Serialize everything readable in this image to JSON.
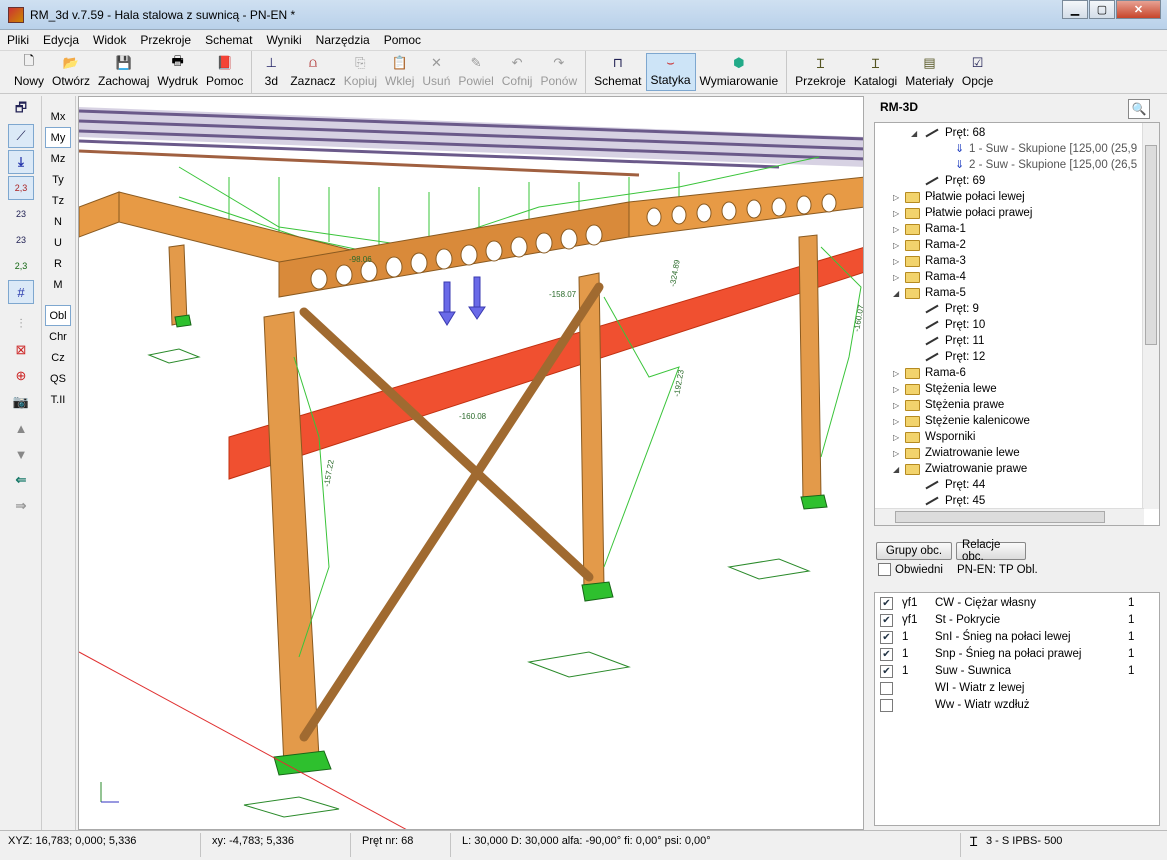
{
  "window": {
    "title": "RM_3d v.7.59 - Hala stalowa z suwnicą - PN-EN *"
  },
  "menu": [
    "Pliki",
    "Edycja",
    "Widok",
    "Przekroje",
    "Schemat",
    "Wyniki",
    "Narzędzia",
    "Pomoc"
  ],
  "toolbar": {
    "file": [
      {
        "label": "Nowy"
      },
      {
        "label": "Otwórz"
      },
      {
        "label": "Zachowaj"
      },
      {
        "label": "Wydruk"
      },
      {
        "label": "Pomoc"
      }
    ],
    "edit": [
      {
        "label": "3d"
      },
      {
        "label": "Zaznacz"
      },
      {
        "label": "Kopiuj"
      },
      {
        "label": "Wklej"
      },
      {
        "label": "Usuń"
      },
      {
        "label": "Powiel"
      },
      {
        "label": "Cofnij"
      },
      {
        "label": "Ponów"
      }
    ],
    "mode": [
      {
        "label": "Schemat"
      },
      {
        "label": "Statyka"
      },
      {
        "label": "Wymiarowanie"
      }
    ],
    "data": [
      {
        "label": "Przekroje"
      },
      {
        "label": "Katalogi"
      },
      {
        "label": "Materiały"
      },
      {
        "label": "Opcje"
      }
    ]
  },
  "result_tabs": [
    "Mx",
    "My",
    "Mz",
    "Ty",
    "Tz",
    "N",
    "U",
    "R",
    "M"
  ],
  "result_tabs2": [
    "Obl",
    "Chr",
    "Cz",
    "QS",
    "T.II"
  ],
  "left_tools_labels": [
    "2,3",
    "23",
    "23",
    "2,3"
  ],
  "viewport": {
    "diagram_labels": [
      "-324.89",
      "-192.23",
      "-157.22",
      "-98.06",
      "-160.08",
      "-158.07",
      "-160.07"
    ]
  },
  "tree": {
    "title": "RM-3D",
    "rows": [
      {
        "type": "member",
        "label": "Pręt: 68",
        "indent": 48,
        "exp": "◢"
      },
      {
        "type": "load",
        "label": "1 - Suw - Skupione [125,00 (25,9",
        "indent": 80
      },
      {
        "type": "load",
        "label": "2 - Suw - Skupione [125,00 (26,5",
        "indent": 80
      },
      {
        "type": "member",
        "label": "Pręt: 69",
        "indent": 48
      },
      {
        "type": "folder",
        "label": "Płatwie połaci lewej",
        "indent": 30,
        "exp": "▷"
      },
      {
        "type": "folder",
        "label": "Płatwie połaci prawej",
        "indent": 30,
        "exp": "▷"
      },
      {
        "type": "folder",
        "label": "Rama-1",
        "indent": 30,
        "exp": "▷"
      },
      {
        "type": "folder",
        "label": "Rama-2",
        "indent": 30,
        "exp": "▷"
      },
      {
        "type": "folder",
        "label": "Rama-3",
        "indent": 30,
        "exp": "▷"
      },
      {
        "type": "folder",
        "label": "Rama-4",
        "indent": 30,
        "exp": "▷"
      },
      {
        "type": "folder",
        "label": "Rama-5",
        "indent": 30,
        "exp": "◢"
      },
      {
        "type": "member",
        "label": "Pręt: 9",
        "indent": 48
      },
      {
        "type": "member",
        "label": "Pręt: 10",
        "indent": 48
      },
      {
        "type": "member",
        "label": "Pręt: 11",
        "indent": 48
      },
      {
        "type": "member",
        "label": "Pręt: 12",
        "indent": 48
      },
      {
        "type": "folder",
        "label": "Rama-6",
        "indent": 30,
        "exp": "▷"
      },
      {
        "type": "folder",
        "label": "Stężenia lewe",
        "indent": 30,
        "exp": "▷"
      },
      {
        "type": "folder",
        "label": "Stężenia prawe",
        "indent": 30,
        "exp": "▷"
      },
      {
        "type": "folder",
        "label": "Stężenie kalenicowe",
        "indent": 30,
        "exp": "▷"
      },
      {
        "type": "folder",
        "label": "Wsporniki",
        "indent": 30,
        "exp": "▷"
      },
      {
        "type": "folder",
        "label": "Zwiatrowanie lewe",
        "indent": 30,
        "exp": "▷"
      },
      {
        "type": "folder",
        "label": "Zwiatrowanie prawe",
        "indent": 30,
        "exp": "◢"
      },
      {
        "type": "member",
        "label": "Pręt: 44",
        "indent": 48
      },
      {
        "type": "member",
        "label": "Pręt: 45",
        "indent": 48
      }
    ]
  },
  "loads_panel": {
    "groups_button": "Grupy obc.",
    "relations_button": "Relacje obc.",
    "envelope_label": "Obwiedni",
    "envelope_checked": false,
    "norm_info": "PN-EN:  TP Obl.",
    "cases": [
      {
        "checked": true,
        "factor": "γf1",
        "name": "CW - Ciężar własny",
        "count": "1"
      },
      {
        "checked": true,
        "factor": "γf1",
        "name": "St - Pokrycie",
        "count": "1"
      },
      {
        "checked": true,
        "factor": "1",
        "name": "SnI - Śnieg na połaci lewej",
        "count": "1"
      },
      {
        "checked": true,
        "factor": "1",
        "name": "Snp - Śnieg na połaci prawej",
        "count": "1"
      },
      {
        "checked": true,
        "factor": "1",
        "name": "Suw - Suwnica",
        "count": "1"
      },
      {
        "checked": false,
        "factor": "",
        "name": "WI - Wiatr z lewej",
        "count": ""
      },
      {
        "checked": false,
        "factor": "",
        "name": "Ww - Wiatr wzdłuż",
        "count": ""
      }
    ]
  },
  "status": {
    "xyz": "XYZ: 16,783; 0,000; 5,336",
    "xy": "xy: -4,783; 5,336",
    "member": "Pręt nr: 68",
    "geometry": "L: 30,000 D: 30,000 alfa: -90,00° fi: 0,00° psi: 0,00°",
    "section": "3 - S IPBS- 500"
  }
}
